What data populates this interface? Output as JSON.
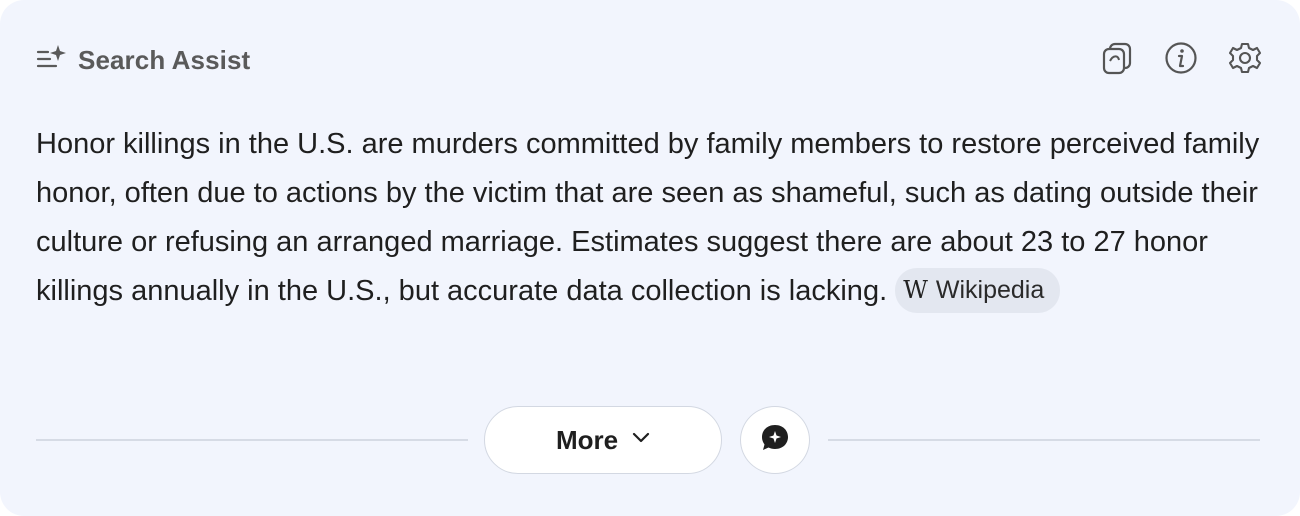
{
  "header": {
    "title": "Search Assist",
    "icons": [
      "assist-sparkle-icon",
      "copy-icon",
      "info-icon",
      "settings-gear-icon"
    ]
  },
  "answer": {
    "text": "Honor killings in the U.S. are murders committed by family members to restore perceived family honor, often due to actions by the victim that are seen as shameful, such as dating outside their culture or refusing an arranged marriage. Estimates suggest there are about 23 to 27 honor killings annually in the U.S., but accurate data collection is lacking.",
    "source": {
      "icon_letter": "W",
      "label": "Wikipedia"
    }
  },
  "footer": {
    "more_label": "More",
    "chat_icon": "chat-bubble-icon"
  },
  "colors": {
    "card_bg": "#f2f5fd",
    "chip_bg": "#e3e7f0",
    "text": "#1f1f1f",
    "muted": "#5a5a5a"
  }
}
